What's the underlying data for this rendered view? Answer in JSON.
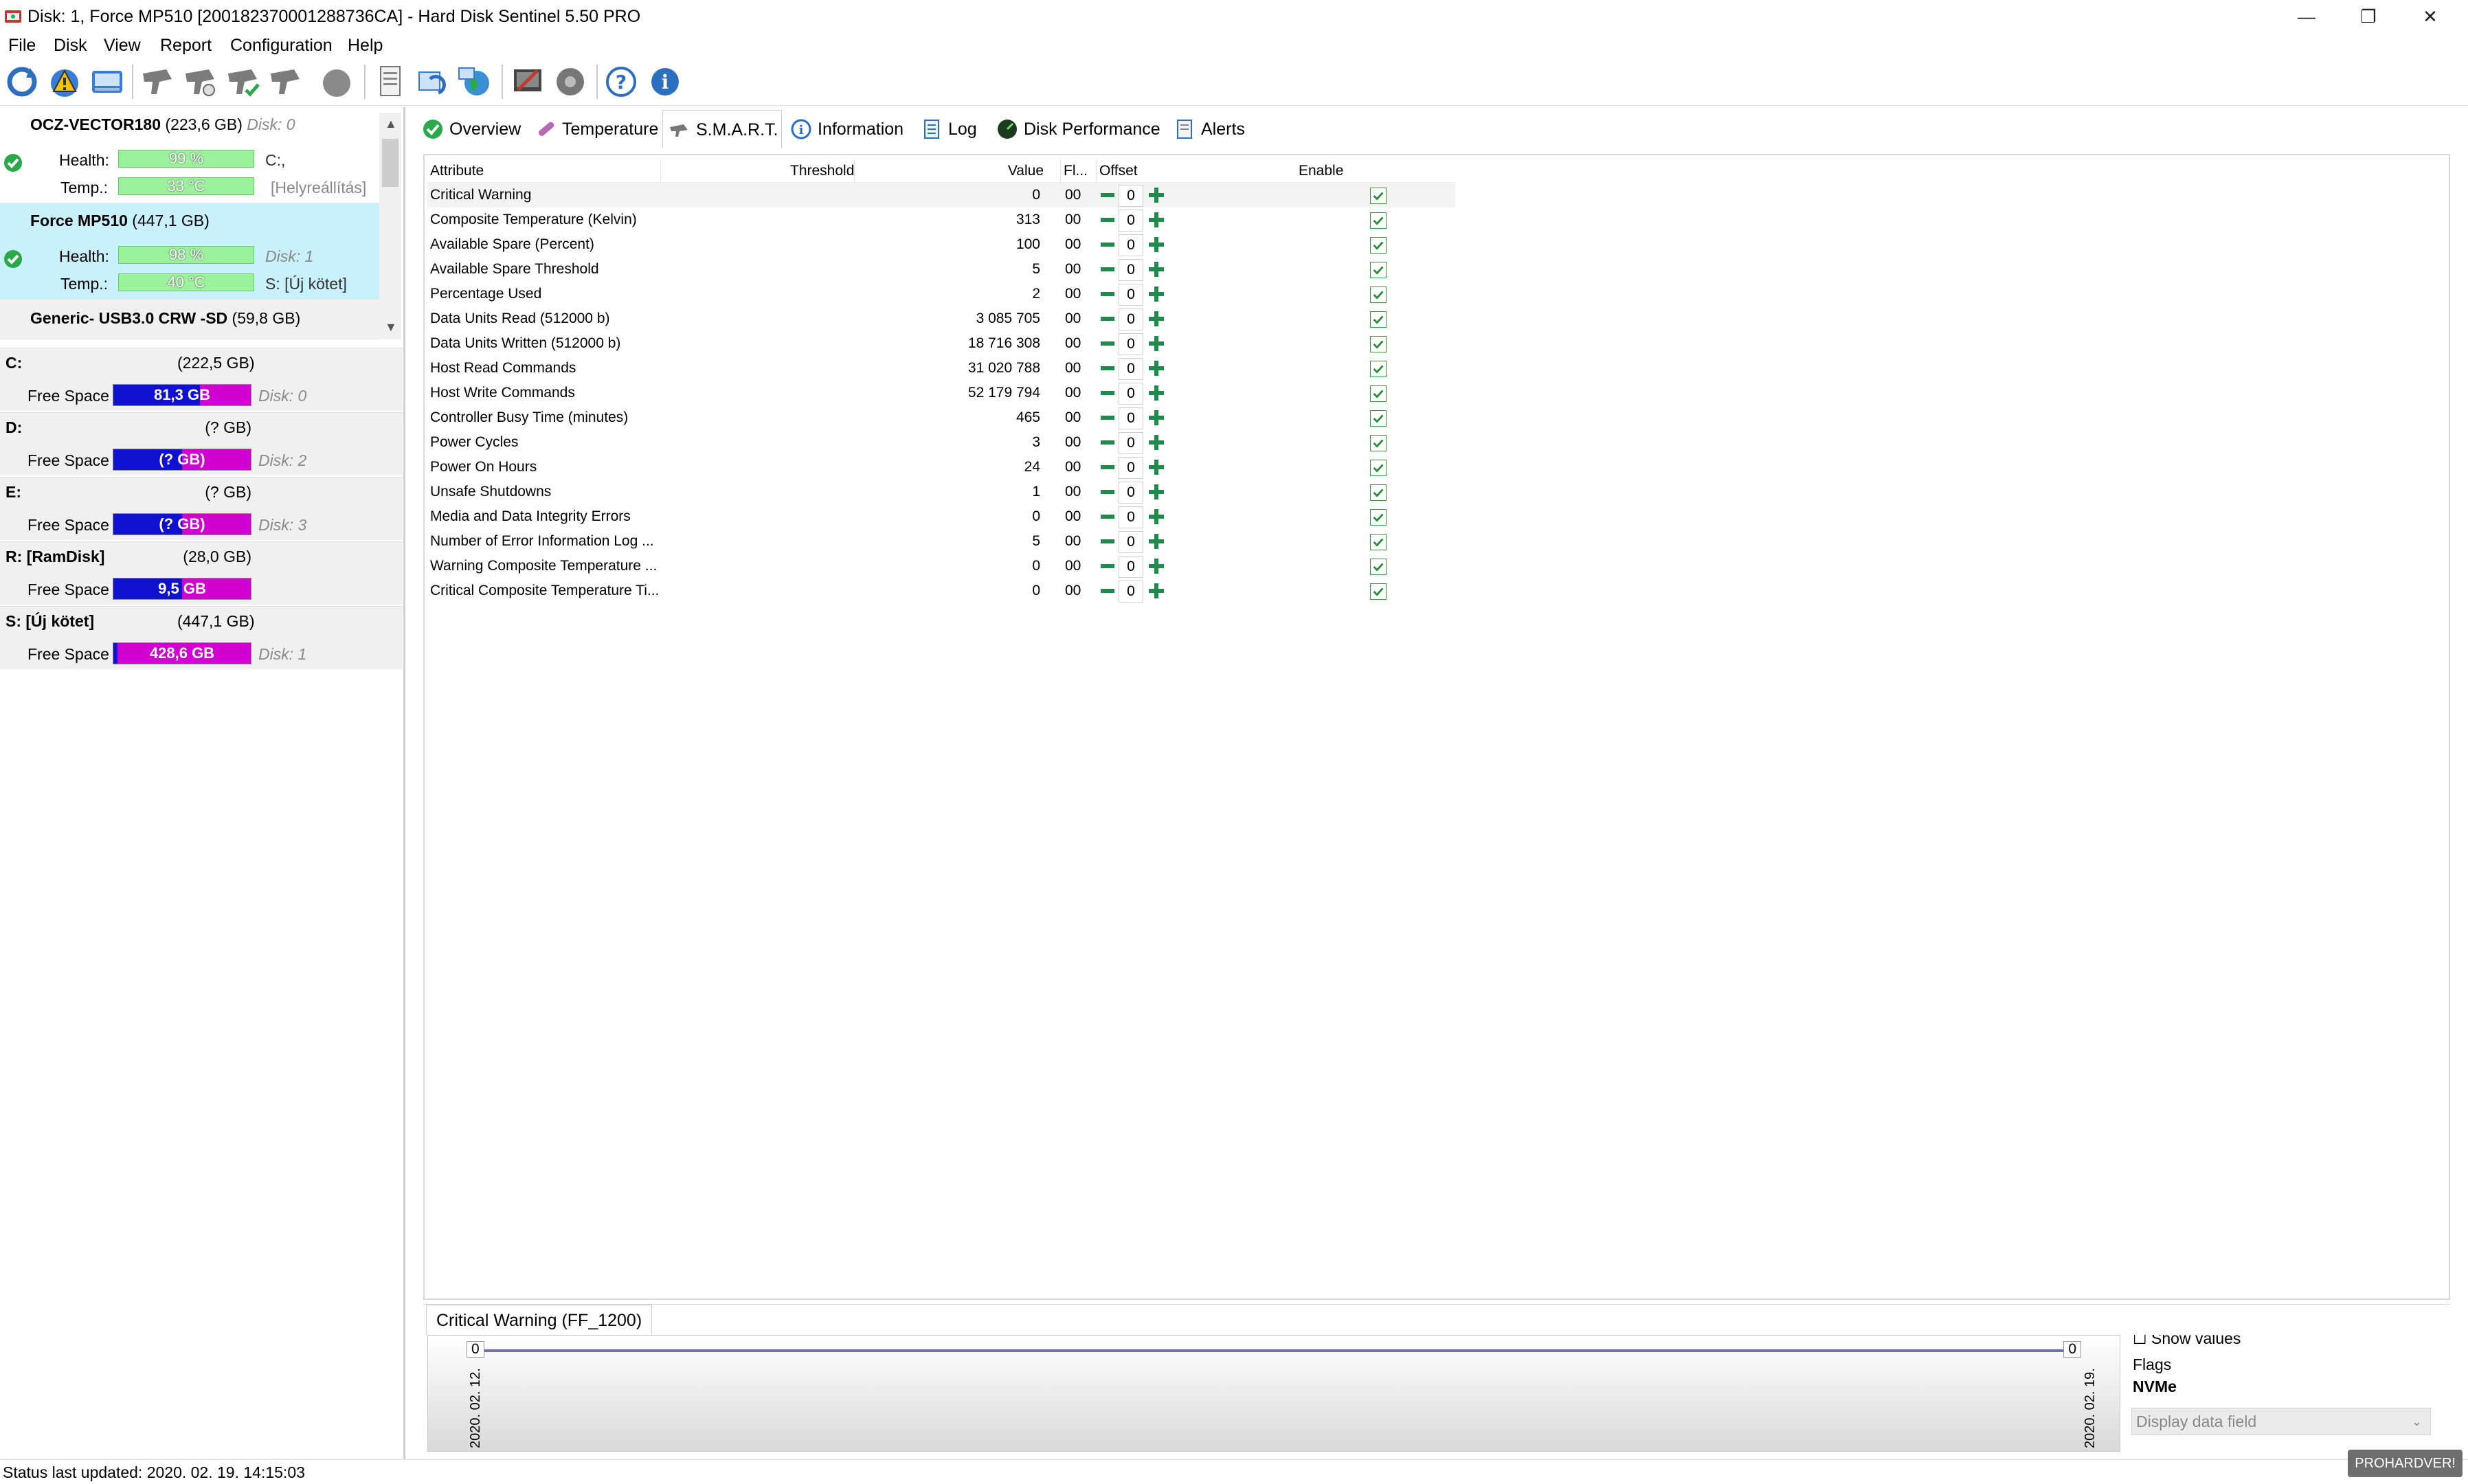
{
  "window": {
    "title": "Disk: 1, Force MP510 [200182370001288736CA]  -  Hard Disk Sentinel 5.50 PRO"
  },
  "menu": [
    "File",
    "Disk",
    "View",
    "Report",
    "Configuration",
    "Help"
  ],
  "toolbar": {
    "icons": [
      "refresh-icon",
      "warning-icon",
      "disk-icon",
      "test-icon",
      "test-icon",
      "test-icon",
      "test-icon",
      "blob-icon",
      "report-icon",
      "sync-icon",
      "globe-icon",
      "tools-icon",
      "sound-icon",
      "help-icon",
      "info-icon"
    ]
  },
  "disks": [
    {
      "name": "OCZ-VECTOR180",
      "size": "(223,6 GB)",
      "disk_id": "Disk: 0",
      "health": "99 %",
      "health_pct": 99,
      "temp": "33 °C",
      "drive": "C:,",
      "note": "[Helyreállítás]"
    },
    {
      "name": "Force MP510",
      "size": "(447,1 GB)",
      "disk_id": "",
      "health": "98 %",
      "health_pct": 98,
      "temp": "40 °C",
      "drive": "Disk: 1",
      "note": "S: [Új kötet]"
    },
    {
      "name": "Generic- USB3.0 CRW   -SD",
      "size": "(59,8 GB)"
    }
  ],
  "labels": {
    "health": "Health:",
    "temp": "Temp.:",
    "free_space": "Free Space"
  },
  "partitions": [
    {
      "name": "C:",
      "size": "(222,5 GB)",
      "free": "81,3 GB",
      "disk": "Disk: 0",
      "free_pct": 63
    },
    {
      "name": "D:",
      "size": "(? GB)",
      "free": "(? GB)",
      "disk": "Disk: 2",
      "free_pct": 50
    },
    {
      "name": "E:",
      "size": "(? GB)",
      "free": "(? GB)",
      "disk": "Disk: 3",
      "free_pct": 50
    },
    {
      "name": "R: [RamDisk]",
      "size": "(28,0 GB)",
      "free": "9,5 GB",
      "disk": "",
      "free_pct": 50
    },
    {
      "name": "S: [Új kötet]",
      "size": "(447,1 GB)",
      "free": "428,6 GB",
      "disk": "Disk: 1",
      "free_pct": 3
    }
  ],
  "tabs": [
    {
      "label": "Overview",
      "icon": "check-icon"
    },
    {
      "label": "Temperature",
      "icon": "thermometer-icon"
    },
    {
      "label": "S.M.A.R.T.",
      "icon": "smart-icon"
    },
    {
      "label": "Information",
      "icon": "info-icon"
    },
    {
      "label": "Log",
      "icon": "log-icon"
    },
    {
      "label": "Disk Performance",
      "icon": "performance-icon"
    },
    {
      "label": "Alerts",
      "icon": "alerts-icon"
    }
  ],
  "smart": {
    "headers": [
      "Attribute",
      "Threshold",
      "Value",
      "Fl...",
      "Offset",
      "Enable"
    ],
    "rows": [
      {
        "attr": "Critical Warning",
        "value": "0",
        "flags": "00",
        "offset": "0"
      },
      {
        "attr": "Composite Temperature (Kelvin)",
        "value": "313",
        "flags": "00",
        "offset": "0"
      },
      {
        "attr": "Available Spare (Percent)",
        "value": "100",
        "flags": "00",
        "offset": "0"
      },
      {
        "attr": "Available Spare Threshold",
        "value": "5",
        "flags": "00",
        "offset": "0"
      },
      {
        "attr": "Percentage Used",
        "value": "2",
        "flags": "00",
        "offset": "0"
      },
      {
        "attr": "Data Units Read (512000 b)",
        "value": "3 085 705",
        "flags": "00",
        "offset": "0"
      },
      {
        "attr": "Data Units Written (512000 b)",
        "value": "18 716 308",
        "flags": "00",
        "offset": "0"
      },
      {
        "attr": "Host Read Commands",
        "value": "31 020 788",
        "flags": "00",
        "offset": "0"
      },
      {
        "attr": "Host Write Commands",
        "value": "52 179 794",
        "flags": "00",
        "offset": "0"
      },
      {
        "attr": "Controller Busy Time (minutes)",
        "value": "465",
        "flags": "00",
        "offset": "0"
      },
      {
        "attr": "Power Cycles",
        "value": "3",
        "flags": "00",
        "offset": "0"
      },
      {
        "attr": "Power On Hours",
        "value": "24",
        "flags": "00",
        "offset": "0"
      },
      {
        "attr": "Unsafe Shutdowns",
        "value": "1",
        "flags": "00",
        "offset": "0"
      },
      {
        "attr": "Media and Data Integrity Errors",
        "value": "0",
        "flags": "00",
        "offset": "0"
      },
      {
        "attr": "Number of Error Information Log ...",
        "value": "5",
        "flags": "00",
        "offset": "0"
      },
      {
        "attr": "Warning Composite Temperature ...",
        "value": "0",
        "flags": "00",
        "offset": "0"
      },
      {
        "attr": "Critical Composite Temperature Ti...",
        "value": "0",
        "flags": "00",
        "offset": "0"
      }
    ]
  },
  "graph": {
    "tab_label": "Critical Warning (FF_1200)",
    "left_value": "0",
    "right_value": "0",
    "left_date": "2020. 02. 12.",
    "right_date": "2020. 02. 19.",
    "show_values": "Show values",
    "flags_label": "Flags",
    "flags_value": "NVMe",
    "display_field": "Display data field"
  },
  "status": "Status last updated: 2020. 02. 19. 14:15:03",
  "watermark": "PROHARDVER!"
}
